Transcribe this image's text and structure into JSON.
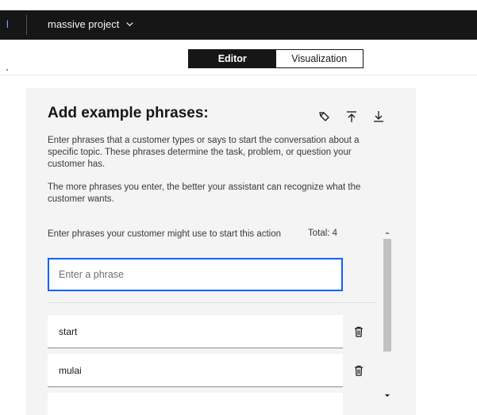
{
  "topbar": {
    "edge_mark": "l",
    "project_name": "massive project"
  },
  "switcher": {
    "editor_label": "Editor",
    "visualization_label": "Visualization"
  },
  "panel": {
    "title": "Add example phrases:",
    "description_1": "Enter phrases that a customer types or says to start the conversation about a specific topic. These phrases determine the task, problem, or question your customer has.",
    "description_2": "The more phrases you enter, the better your assistant can recognize what the customer wants.",
    "field_label": "Enter phrases your customer might use to start this action",
    "total_label": "Total: 4",
    "input_placeholder": "Enter a phrase",
    "input_value": "",
    "phrases": [
      "start",
      "mulai",
      ""
    ]
  },
  "icons": {
    "edit": "pencil-icon",
    "upload": "upload-icon",
    "download": "download-icon",
    "delete": "trash-icon",
    "project_menu": "chevron-down-icon"
  },
  "colors": {
    "focus": "#0f62fe",
    "topbar": "#161616",
    "panel": "#f4f4f4"
  }
}
